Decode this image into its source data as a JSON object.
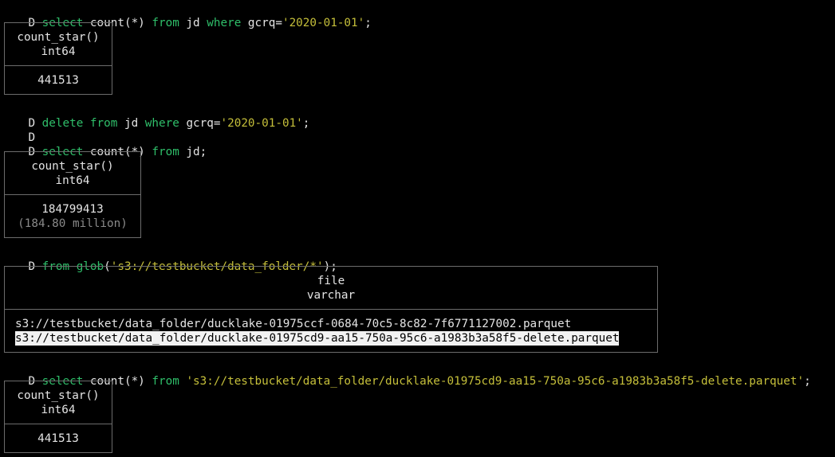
{
  "prompt_char": "D",
  "commands": {
    "c1": {
      "kw1": "select",
      "t1": " count(*) ",
      "kw2": "from",
      "t2": " jd ",
      "kw3": "where",
      "t3": " gcrq=",
      "str": "'2020-01-01'",
      "t4": ";"
    },
    "c2": {
      "kw1": "delete",
      "t1": " ",
      "kw2": "from",
      "t2": " jd ",
      "kw3": "where",
      "t3": " gcrq=",
      "str": "'2020-01-01'",
      "t4": ";"
    },
    "c3": {
      "kw1": "select",
      "t1": " count(*) ",
      "kw2": "from",
      "t2": " jd;"
    },
    "c4": {
      "kw1": "from",
      "t1": " ",
      "kw2": "glob",
      "t2": "(",
      "str": "'s3://testbucket/data_folder/*'",
      "t3": ");"
    },
    "c5": {
      "kw1": "select",
      "t1": " count(*) ",
      "kw2": "from",
      "t2": " ",
      "str": "'s3://testbucket/data_folder/ducklake-01975cd9-aa15-750a-95c6-a1983b3a58f5-delete.parquet'",
      "t3": ";"
    }
  },
  "results": {
    "r1": {
      "column": "count_star()",
      "type": "int64",
      "value": "441513"
    },
    "r2": {
      "column": "count_star()",
      "type": "int64",
      "value": "184799413",
      "approx": "(184.80 million)"
    },
    "r3": {
      "column": "file",
      "type": "varchar",
      "rows": [
        "s3://testbucket/data_folder/ducklake-01975ccf-0684-70c5-8c82-7f6771127002.parquet",
        "s3://testbucket/data_folder/ducklake-01975cd9-aa15-750a-95c6-a1983b3a58f5-delete.parquet"
      ]
    },
    "r4": {
      "column": "count_star()",
      "type": "int64",
      "value": "441513"
    }
  },
  "colors": {
    "keyword": "#2fbf6a",
    "string": "#c5bf3a",
    "text": "#e4e4e4",
    "border": "#6c6c6c",
    "dim": "#8a8a8a",
    "background": "#000000"
  }
}
